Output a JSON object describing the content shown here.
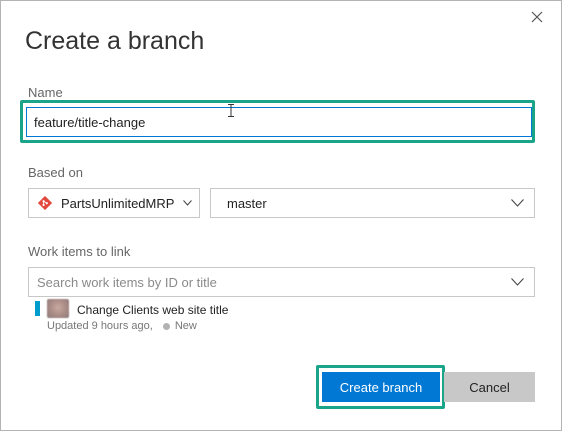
{
  "dialog": {
    "title": "Create a branch",
    "close_icon": "close-icon"
  },
  "name": {
    "label": "Name",
    "value": "feature/title-change"
  },
  "based_on": {
    "label": "Based on",
    "repository": "PartsUnlimitedMRP",
    "repository_icon": "git-icon",
    "branch": "master"
  },
  "work_items": {
    "label": "Work items to link",
    "placeholder": "Search work items by ID or title",
    "linked": [
      {
        "title": "Change Clients web site title",
        "updated": "Updated 9 hours ago,",
        "state": "New"
      }
    ]
  },
  "buttons": {
    "create": "Create branch",
    "cancel": "Cancel"
  },
  "colors": {
    "primary": "#0078d4",
    "highlight": "#1aa58a",
    "work_item_bar": "#009ccc",
    "git_icon": "#e2483d"
  }
}
